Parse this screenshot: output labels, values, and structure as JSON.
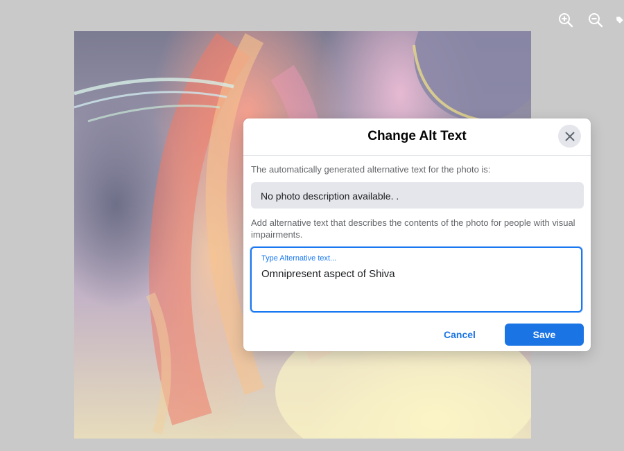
{
  "toolbar": {
    "icons": [
      "zoom-in-icon",
      "zoom-out-icon",
      "tag-icon"
    ]
  },
  "modal": {
    "title": "Change Alt Text",
    "auto_label": "The automatically generated alternative text for the photo is:",
    "auto_text": "No photo description available. .",
    "add_label": "Add alternative text that describes the contents of the photo for people with visual impairments.",
    "alt_placeholder": "Type Alternative text...",
    "alt_value": "Omnipresent aspect of Shiva",
    "cancel_label": "Cancel",
    "save_label": "Save"
  },
  "colors": {
    "accent": "#1b74e4",
    "overlay": "#c9c9ca",
    "close_bg": "#e4e6eb"
  }
}
